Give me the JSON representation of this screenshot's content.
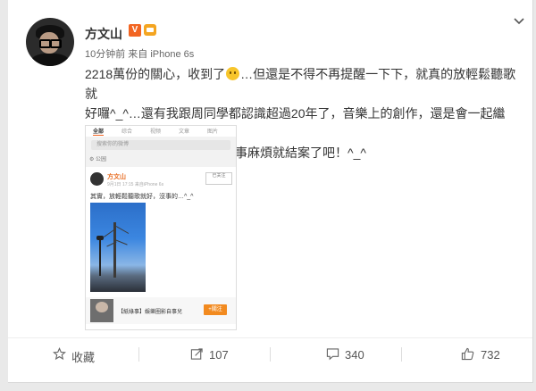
{
  "post": {
    "author": "方文山",
    "verified_badge": "V",
    "meta": "10分钟前 来自 iPhone 6s",
    "text_line1_a": "2218萬份的關心，收到了",
    "text_line1_b": "…但還是不得不再提醒一下下，就真的放輕鬆聽歌就",
    "text_line2": "好囉^_^…還有我跟周同學都認識超過20年了，音樂上的創作，還是會一起繼續",
    "text_line3": "的…最後，一個小叮嚀，此事麻煩就結案了吧！^_^",
    "more_icon": "chevron-down-icon"
  },
  "embedded": {
    "tabs": [
      "全部",
      "综合",
      "视频",
      "文章",
      "图片"
    ],
    "search_placeholder": "搜索你的微博",
    "location": "公园",
    "author": "方文山",
    "meta": "9月1日 17:15 来自iPhone 6s",
    "follow": "已关注",
    "text": "其實，放輕鬆聽歌就好，沒事的…^_^",
    "ad_text": "【紙綠事】娛樂圈影自事兒",
    "ad_button": "+關注"
  },
  "actions": {
    "favorite_label": "收藏",
    "forward_count": "107",
    "comment_count": "340",
    "like_count": "732"
  },
  "colors": {
    "accent": "#f26522",
    "text": "#333333",
    "muted": "#666666"
  }
}
